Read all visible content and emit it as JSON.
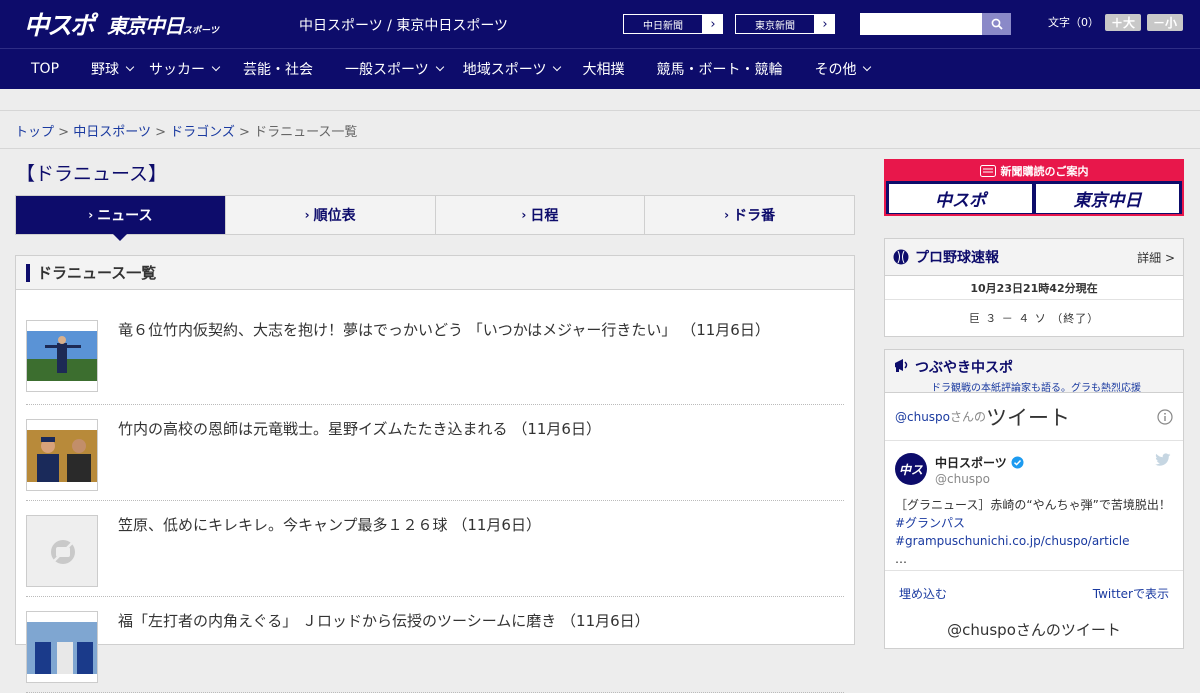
{
  "header": {
    "logo_primary": "中スポ",
    "logo_secondary": "東京中日",
    "logo_secondary_small": "スポーツ",
    "site_name": "中日スポーツ / 東京中日スポーツ",
    "papers": [
      {
        "label": "中日新聞"
      },
      {
        "label": "東京新聞"
      }
    ],
    "search_placeholder": "",
    "font_label": "文字（0）",
    "font_up": "＋大",
    "font_down": "－小"
  },
  "nav": [
    {
      "label": "TOP",
      "dropdown": false
    },
    {
      "label": "野球",
      "dropdown": true
    },
    {
      "label": "サッカー",
      "dropdown": true
    },
    {
      "label": "芸能・社会",
      "dropdown": false
    },
    {
      "label": "一般スポーツ",
      "dropdown": true
    },
    {
      "label": "地域スポーツ",
      "dropdown": true
    },
    {
      "label": "大相撲",
      "dropdown": false
    },
    {
      "label": "競馬・ボート・競輪",
      "dropdown": false
    },
    {
      "label": "その他",
      "dropdown": true
    }
  ],
  "breadcrumb": {
    "home": "トップ",
    "site": "中日スポーツ",
    "section": "ドラゴンズ",
    "current": "ドラニュース一覧",
    "sep": ">"
  },
  "page_title": "【ドラニュース】",
  "tabs": [
    {
      "label": "ニュース",
      "active": true
    },
    {
      "label": "順位表",
      "active": false
    },
    {
      "label": "日程",
      "active": false
    },
    {
      "label": "ドラ番",
      "active": false
    }
  ],
  "list": {
    "heading": "ドラニュース一覧",
    "items": [
      {
        "title": "竜６位竹内仮契約、大志を抱け！夢はでっかいどう 「いつかはメジャー行きたい」 （11月6日）",
        "thumb": "photo-sky"
      },
      {
        "title": "竹内の高校の恩師は元竜戦士。星野イズムたたき込まれる （11月6日）",
        "thumb": "photo-people"
      },
      {
        "title": "笠原、低めにキレキレ。今キャンプ最多１２６球 （11月6日）",
        "thumb": "no-image"
      },
      {
        "title": "福「左打者の内角えぐる」 Ｊロッドから伝授のツーシームに磨き （11月6日）",
        "thumb": "photo-people"
      }
    ]
  },
  "subscribe": {
    "heading": "新聞購読のご案内",
    "btn1": "中スポ",
    "btn2": "東京中日"
  },
  "baseball": {
    "title": "プロ野球速報",
    "detail": "詳細 >",
    "timestamp": "10月23日21時42分現在",
    "score": "巨 ３ － ４ ソ （終了）"
  },
  "twitter": {
    "title": "つぶやき中スポ",
    "subtitle": "ドラ観戦の本紙評論家も語る。グラも熱烈応援",
    "by_handle": "@chuspo",
    "by_suffix": "さんの",
    "by_label": "ツイート",
    "tweet": {
      "name": "中日スポーツ",
      "handle": "@chuspo",
      "text": "［グラニュース］赤崎の“やんちゃ弾”で苦境脱出！",
      "link": "#グランパス #grampuschunichi.co.jp/chuspo/article",
      "ellipsis": "…"
    },
    "embed": "埋め込む",
    "view": "Twitterで表示",
    "more": "@chuspoさんのツイート"
  }
}
